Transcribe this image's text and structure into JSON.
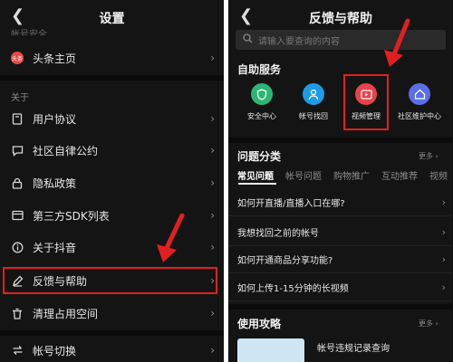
{
  "left": {
    "title": "设置",
    "cut_section": "帐号安全",
    "section_about": "关于",
    "items": [
      {
        "label": "头条主页",
        "icon": "toutiao-badge",
        "badge_text": "头条"
      },
      {
        "label": "用户协议",
        "icon": "book-icon"
      },
      {
        "label": "社区自律公约",
        "icon": "chat-icon"
      },
      {
        "label": "隐私政策",
        "icon": "lock-icon"
      },
      {
        "label": "第三方SDK列表",
        "icon": "list-icon"
      },
      {
        "label": "关于抖音",
        "icon": "info-icon"
      },
      {
        "label": "反馈与帮助",
        "icon": "edit-icon"
      },
      {
        "label": "清理占用空间",
        "icon": "trash-icon"
      },
      {
        "label": "帐号切换",
        "icon": "switch-icon"
      }
    ]
  },
  "right": {
    "title": "反馈与帮助",
    "search_placeholder": "请输入要查询的内容",
    "self_service_title": "自助服务",
    "services": [
      {
        "label": "安全中心",
        "color": "#2bb673",
        "icon": "shield-icon"
      },
      {
        "label": "帐号找回",
        "color": "#1e9be8",
        "icon": "user-icon"
      },
      {
        "label": "视频管理",
        "color": "#e8424a",
        "icon": "video-icon"
      },
      {
        "label": "社区维护中心",
        "color": "#5a6ee8",
        "icon": "home-icon"
      }
    ],
    "categories_title": "问题分类",
    "more": "更多",
    "tabs": [
      "常见问题",
      "帐号问题",
      "购物推广",
      "互动推荐",
      "视频"
    ],
    "questions": [
      "如何开直播/直播入口在哪?",
      "我想找回之前的帐号",
      "如何开通商品分享功能?",
      "如何上传1-15分钟的长视频"
    ],
    "guide_title": "使用攻略",
    "guide_item": "帐号违规记录查询"
  },
  "accent": "#e02020"
}
